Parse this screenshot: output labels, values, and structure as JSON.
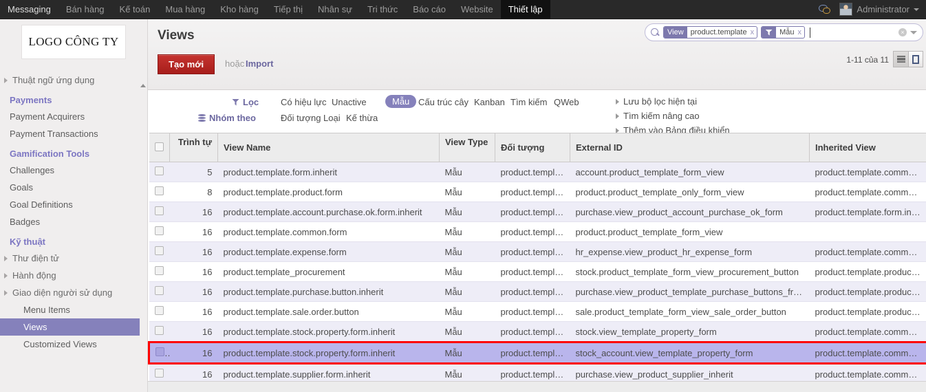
{
  "topbar": {
    "nav": [
      {
        "label": "Messaging",
        "active": false
      },
      {
        "label": "Bán hàng",
        "active": false
      },
      {
        "label": "Kế toán",
        "active": false
      },
      {
        "label": "Mua hàng",
        "active": false
      },
      {
        "label": "Kho hàng",
        "active": false
      },
      {
        "label": "Tiếp thị",
        "active": false
      },
      {
        "label": "Nhân sự",
        "active": false
      },
      {
        "label": "Tri thức",
        "active": false
      },
      {
        "label": "Báo cáo",
        "active": false
      },
      {
        "label": "Website",
        "active": false
      },
      {
        "label": "Thiết lập",
        "active": true
      }
    ],
    "chat_icon": "chat-bubble-icon",
    "user_name": "Administrator",
    "user_caret": "chevron-down-icon"
  },
  "sidebar": {
    "logo_text": "LOGO CÔNG TY",
    "scroll_arrow": "scroll-up-arrow-icon",
    "items": [
      {
        "type": "toggle",
        "label": "Thuật ngữ ứng dụng"
      },
      {
        "type": "section",
        "label": "Payments"
      },
      {
        "type": "leaf",
        "label": "Payment Acquirers"
      },
      {
        "type": "leaf",
        "label": "Payment Transactions"
      },
      {
        "type": "section",
        "label": "Gamification Tools"
      },
      {
        "type": "leaf",
        "label": "Challenges"
      },
      {
        "type": "leaf",
        "label": "Goals"
      },
      {
        "type": "leaf",
        "label": "Goal Definitions"
      },
      {
        "type": "leaf",
        "label": "Badges"
      },
      {
        "type": "section",
        "label": "Kỹ thuật"
      },
      {
        "type": "toggle",
        "label": "Thư điện tử"
      },
      {
        "type": "toggle",
        "label": "Hành động"
      },
      {
        "type": "toggle",
        "label": "Giao diện người sử dụng"
      },
      {
        "type": "sub",
        "label": "Menu Items",
        "active": false
      },
      {
        "type": "sub",
        "label": "Views",
        "active": true
      },
      {
        "type": "sub",
        "label": "Customized Views",
        "active": false
      }
    ]
  },
  "control": {
    "page_title": "Views",
    "create_button": "Tạo mới",
    "or_text": "hoặc",
    "import_link": "Import",
    "pager": "1-11 của 11",
    "view_list_icon": "list-view-icon",
    "view_form_icon": "form-view-icon"
  },
  "search": {
    "icon": "search-icon",
    "placeholder": "",
    "value": "",
    "facets": [
      {
        "key": "View",
        "value": "product.template",
        "remove": "x",
        "icon": null
      },
      {
        "key": "",
        "value": "Mẫu",
        "remove": "x",
        "icon": "filter-funnel-icon"
      }
    ],
    "clear_icon": "clear-circle-icon",
    "dropdown_icon": "chevron-down-icon"
  },
  "filters": {
    "filter_label": "Lọc",
    "filter_icon": "filter-funnel-icon",
    "group_label": "Nhóm theo",
    "group_icon": "database-icon",
    "filter_options": [
      "Có hiệu lực",
      "Unactive"
    ],
    "view_types": [
      "Mẫu",
      "Cấu trúc cây",
      "Kanban",
      "Tìm kiếm",
      "QWeb"
    ],
    "active_view_type": "Mẫu",
    "group_options": [
      "Đối tượng",
      "Loại",
      "Kế thừa"
    ],
    "right_links": [
      "Lưu bộ lọc hiện tại",
      "Tìm kiếm nâng cao",
      "Thêm vào Bảng điều khiển"
    ]
  },
  "table": {
    "columns": [
      "Trình tự",
      "View Name",
      "View Type",
      "Đối tượng",
      "External ID",
      "Inherited View"
    ],
    "rows": [
      {
        "seq": "5",
        "name": "product.template.form.inherit",
        "view_type": "Mẫu",
        "object": "product.template",
        "external_id": "account.product_template_form_view",
        "inherited": "product.template.common.form",
        "selected": false
      },
      {
        "seq": "8",
        "name": "product.template.product.form",
        "view_type": "Mẫu",
        "object": "product.template",
        "external_id": "product.product_template_only_form_view",
        "inherited": "product.template.common.form",
        "selected": false
      },
      {
        "seq": "16",
        "name": "product.template.account.purchase.ok.form.inherit",
        "view_type": "Mẫu",
        "object": "product.template",
        "external_id": "purchase.view_product_account_purchase_ok_form",
        "inherited": "product.template.form.inherit",
        "selected": false
      },
      {
        "seq": "16",
        "name": "product.template.common.form",
        "view_type": "Mẫu",
        "object": "product.template",
        "external_id": "product.product_template_form_view",
        "inherited": "",
        "selected": false
      },
      {
        "seq": "16",
        "name": "product.template.expense.form",
        "view_type": "Mẫu",
        "object": "product.template",
        "external_id": "hr_expense.view_product_hr_expense_form",
        "inherited": "product.template.common.form",
        "selected": false
      },
      {
        "seq": "16",
        "name": "product.template_procurement",
        "view_type": "Mẫu",
        "object": "product.template",
        "external_id": "stock.product_template_form_view_procurement_button",
        "inherited": "product.template.product.form",
        "selected": false
      },
      {
        "seq": "16",
        "name": "product.template.purchase.button.inherit",
        "view_type": "Mẫu",
        "object": "product.template",
        "external_id": "purchase.view_product_template_purchase_buttons_from",
        "inherited": "product.template.product.form",
        "selected": false
      },
      {
        "seq": "16",
        "name": "product.template.sale.order.button",
        "view_type": "Mẫu",
        "object": "product.template",
        "external_id": "sale.product_template_form_view_sale_order_button",
        "inherited": "product.template.product.form",
        "selected": false
      },
      {
        "seq": "16",
        "name": "product.template.stock.property.form.inherit",
        "view_type": "Mẫu",
        "object": "product.template",
        "external_id": "stock.view_template_property_form",
        "inherited": "product.template.common.form",
        "selected": false
      },
      {
        "seq": "16",
        "name": "product.template.stock.property.form.inherit",
        "view_type": "Mẫu",
        "object": "product.template",
        "external_id": "stock_account.view_template_property_form",
        "inherited": "product.template.common.form",
        "selected": true
      },
      {
        "seq": "16",
        "name": "product.template.supplier.form.inherit",
        "view_type": "Mẫu",
        "object": "product.template",
        "external_id": "purchase.view_product_supplier_inherit",
        "inherited": "product.template.common.form",
        "selected": false
      }
    ]
  },
  "colors": {
    "accent_purple": "#8581bb",
    "link_purple": "#6b679f",
    "create_red": "#a71e1b",
    "selection_red": "#ff0000",
    "row_odd": "#eeedf7",
    "row_selected": "#b9b5ec",
    "topbar_dark": "#292929"
  }
}
